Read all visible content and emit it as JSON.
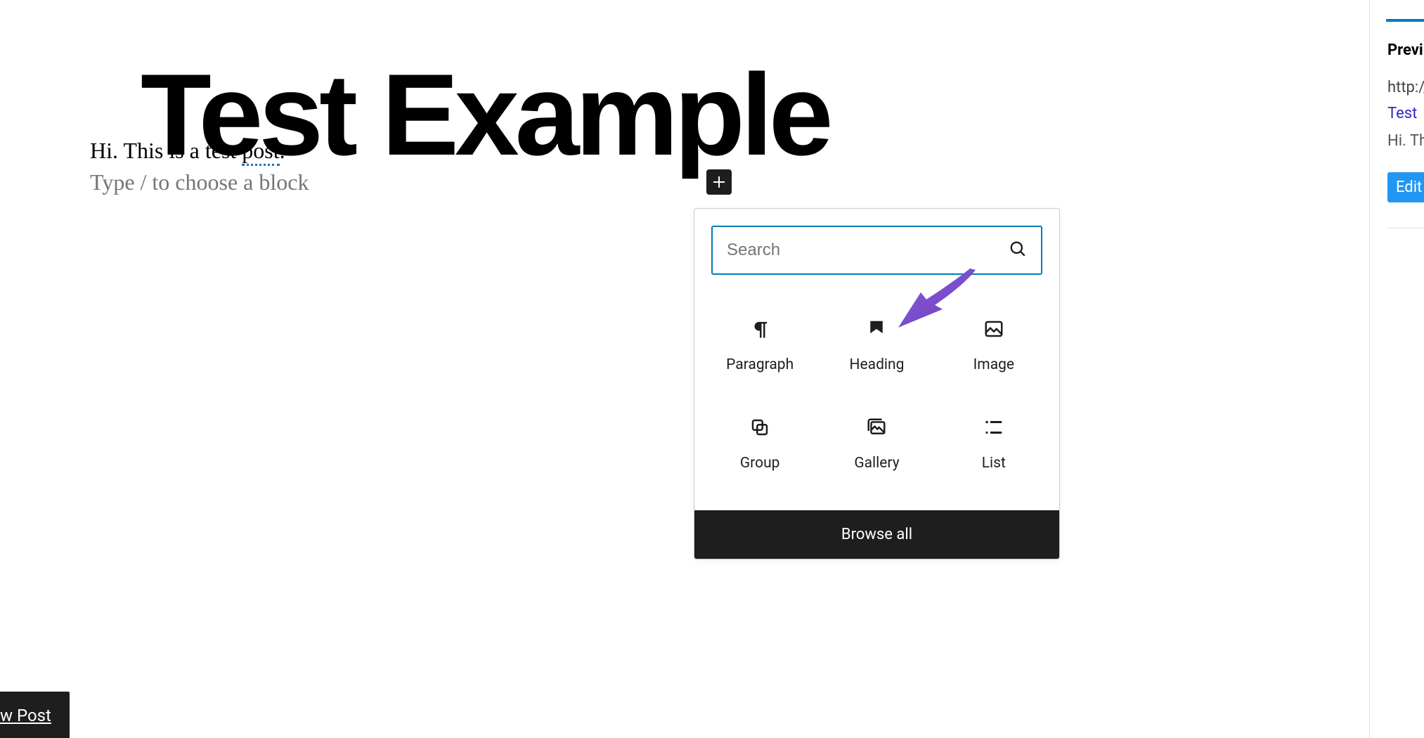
{
  "post": {
    "title": "Test Example",
    "body_prefix": "Hi. This is a test ",
    "body_spell": "post",
    "body_suffix": ".",
    "placeholder": "Type / to choose a block"
  },
  "inserter": {
    "search_placeholder": "Search",
    "blocks": {
      "paragraph": "Paragraph",
      "heading": "Heading",
      "image": "Image",
      "group": "Group",
      "gallery": "Gallery",
      "list": "List"
    },
    "browse_all": "Browse all"
  },
  "sidebar": {
    "preview_label": "Previ",
    "url": "http://",
    "link_title": "Test ",
    "snippet": "Hi. Th",
    "edit_label": "Edit"
  },
  "footer": {
    "new_post": "w Post"
  }
}
